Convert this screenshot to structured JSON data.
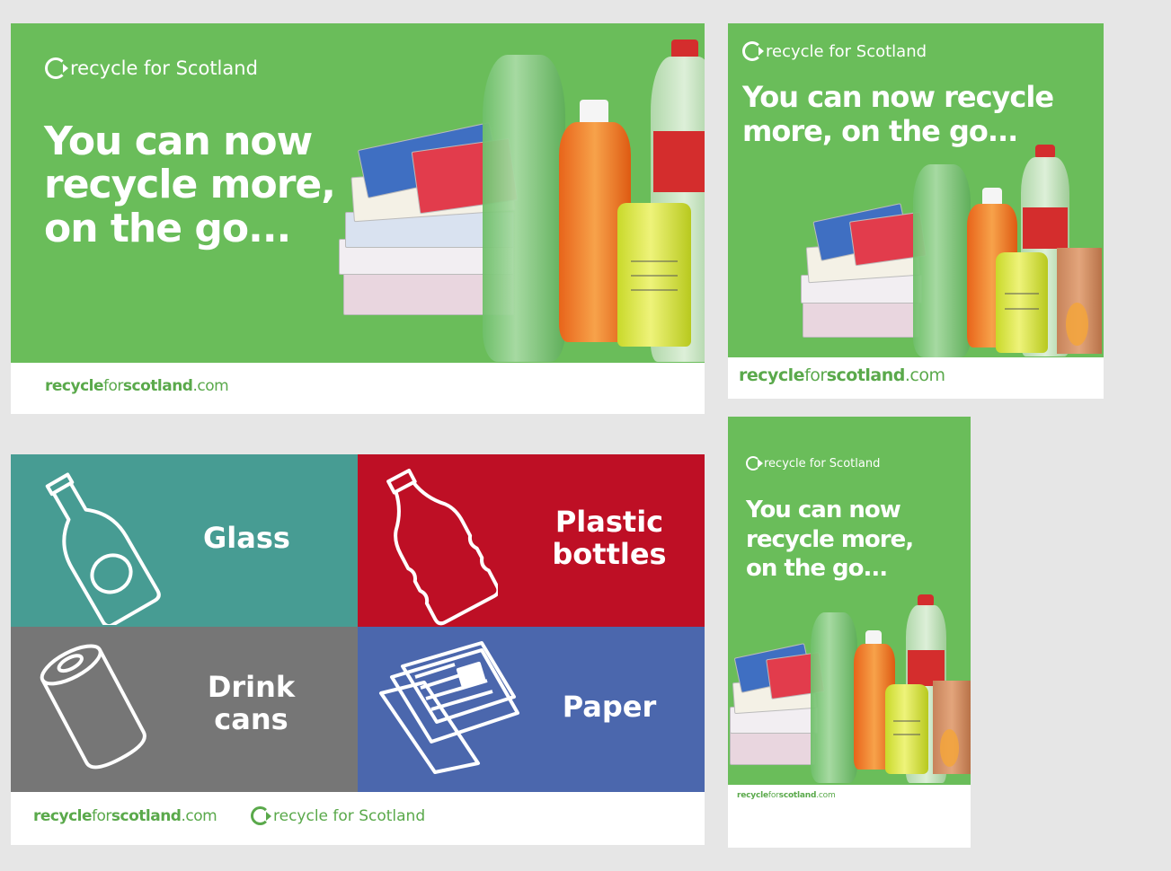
{
  "brand": "recycle for Scotland",
  "headline": "You can now recycle more, on the go...",
  "headline_lines_large": [
    "You can now",
    "recycle more,",
    "on the go..."
  ],
  "headline_lines_medium": [
    "You can now recycle",
    "more, on the go..."
  ],
  "headline_lines_small": [
    "You can now",
    "recycle more,",
    "on the go..."
  ],
  "website": {
    "part1": "recycle",
    "part2": "for",
    "part3": "scotland",
    "part4": ".com"
  },
  "icons": [
    "recycle-arrow-icon",
    "glass-bottle-icon",
    "plastic-bottle-icon",
    "drink-can-icon",
    "newspaper-icon"
  ],
  "tiles": [
    {
      "lines": [
        "Glass"
      ],
      "color": "#479c93"
    },
    {
      "lines": [
        "Plastic",
        "bottles"
      ],
      "color": "#be0f25"
    },
    {
      "lines": [
        "Drink",
        "cans"
      ],
      "color": "#767676"
    },
    {
      "lines": [
        "Paper"
      ],
      "color": "#4b67ad"
    }
  ],
  "colors": {
    "green": "#6abd5a",
    "brand_green": "#5aa94b",
    "background": "#e6e6e6"
  }
}
